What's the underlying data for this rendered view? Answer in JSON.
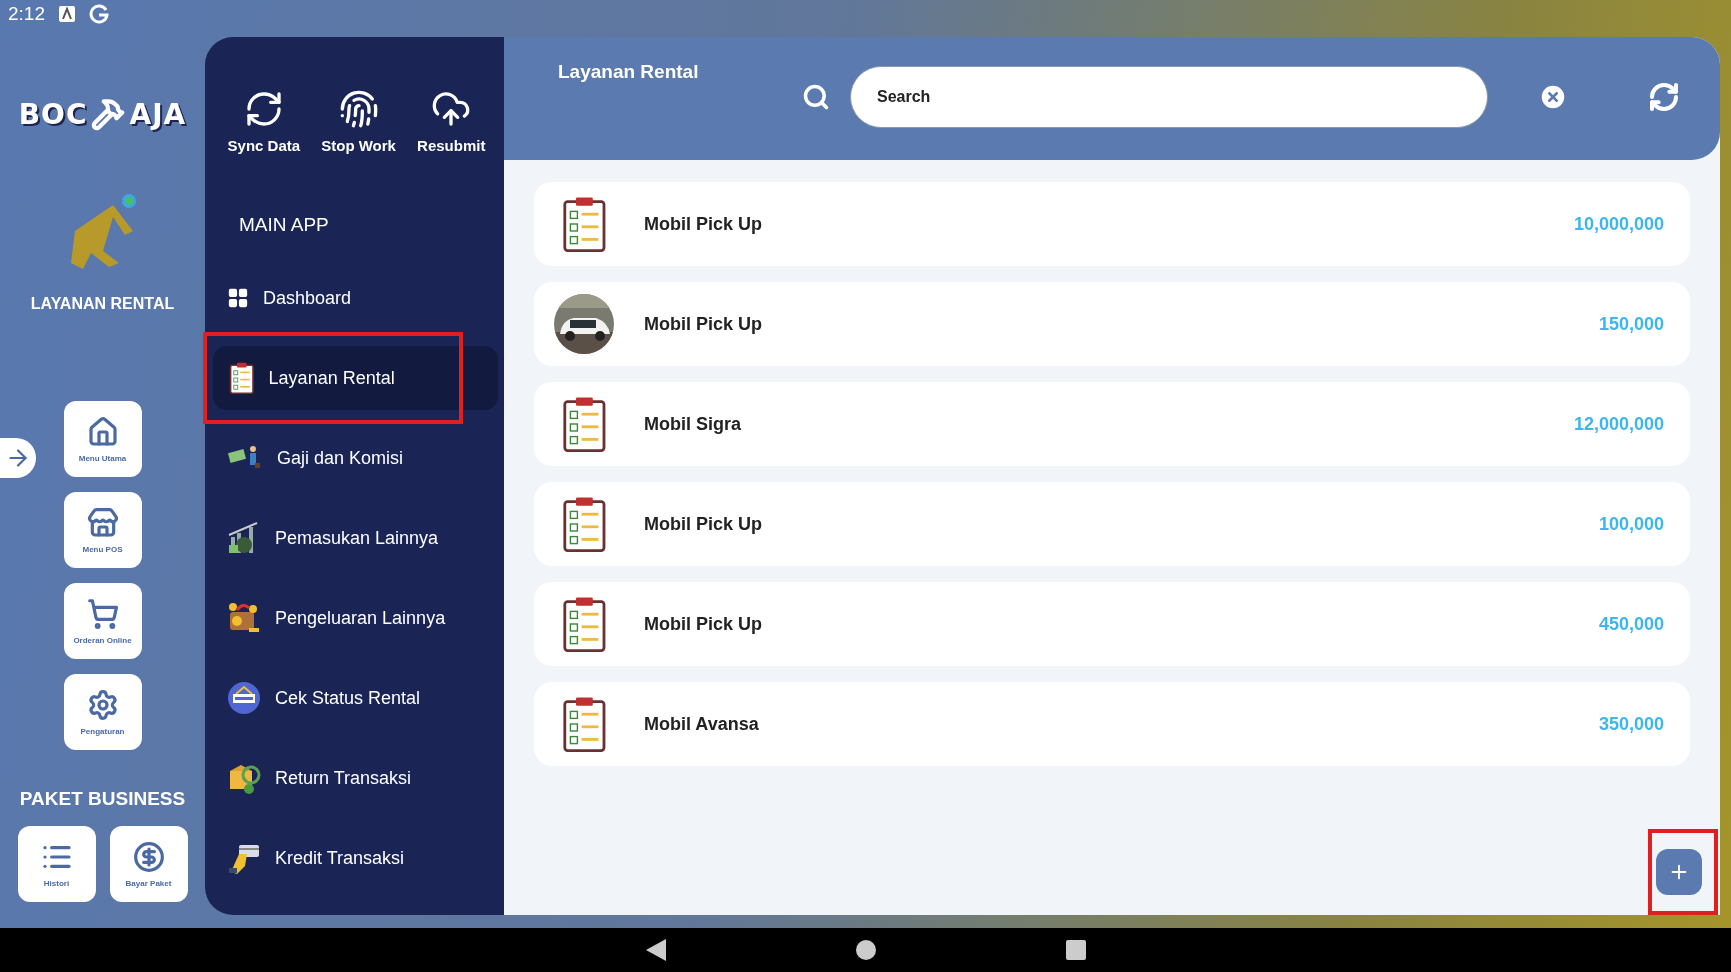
{
  "status_bar": {
    "time": "2:12"
  },
  "logo": {
    "left": "BOC",
    "right": "AJA"
  },
  "app": {
    "label": "LAYANAN RENTAL"
  },
  "rail_buttons": [
    {
      "label": "Menu Utama",
      "kind": "home"
    },
    {
      "label": "Menu POS",
      "kind": "store"
    },
    {
      "label": "Orderan Online",
      "kind": "cart"
    },
    {
      "label": "Pengaturan",
      "kind": "gear"
    }
  ],
  "package": {
    "title": "PAKET BUSINESS",
    "buttons": [
      {
        "label": "Histori",
        "kind": "list"
      },
      {
        "label": "Bayar Paket",
        "kind": "dollar"
      }
    ]
  },
  "actions": [
    {
      "label": "Sync Data",
      "kind": "sync"
    },
    {
      "label": "Stop Work",
      "kind": "fingerprint"
    },
    {
      "label": "Resubmit",
      "kind": "upload"
    }
  ],
  "section": "MAIN APP",
  "menu": [
    {
      "label": "Dashboard",
      "kind": "grid",
      "selected": false,
      "highlighted": false
    },
    {
      "label": "Layanan Rental",
      "kind": "clipboard",
      "selected": true,
      "highlighted": true
    },
    {
      "label": "Gaji dan Komisi",
      "kind": "money",
      "selected": false,
      "highlighted": false
    },
    {
      "label": "Pemasukan Lainnya",
      "kind": "chart",
      "selected": false,
      "highlighted": false
    },
    {
      "label": "Pengeluaran Lainnya",
      "kind": "wallet",
      "selected": false,
      "highlighted": false
    },
    {
      "label": "Cek Status Rental",
      "kind": "rent",
      "selected": false,
      "highlighted": false
    },
    {
      "label": "Return Transaksi",
      "kind": "box",
      "selected": false,
      "highlighted": false
    },
    {
      "label": "Kredit Transaksi",
      "kind": "card",
      "selected": false,
      "highlighted": false
    }
  ],
  "header": {
    "title": "Layanan Rental",
    "search": {
      "placeholder": "Search"
    }
  },
  "items": [
    {
      "name": "Mobil Pick Up",
      "price": "10,000,000",
      "kind": "clipboard"
    },
    {
      "name": "Mobil Pick Up",
      "price": "150,000"
    },
    {
      "name": "Mobil Sigra",
      "price": "12,000,000",
      "kind": "clipboard"
    },
    {
      "name": "Mobil Pick Up",
      "price": "100,000",
      "kind": "clipboard"
    },
    {
      "name": "Mobil Pick Up",
      "price": "450,000",
      "kind": "clipboard"
    },
    {
      "name": "Mobil Avansa",
      "price": "350,000",
      "kind": "clipboard"
    }
  ],
  "fab": {
    "highlighted": true
  }
}
